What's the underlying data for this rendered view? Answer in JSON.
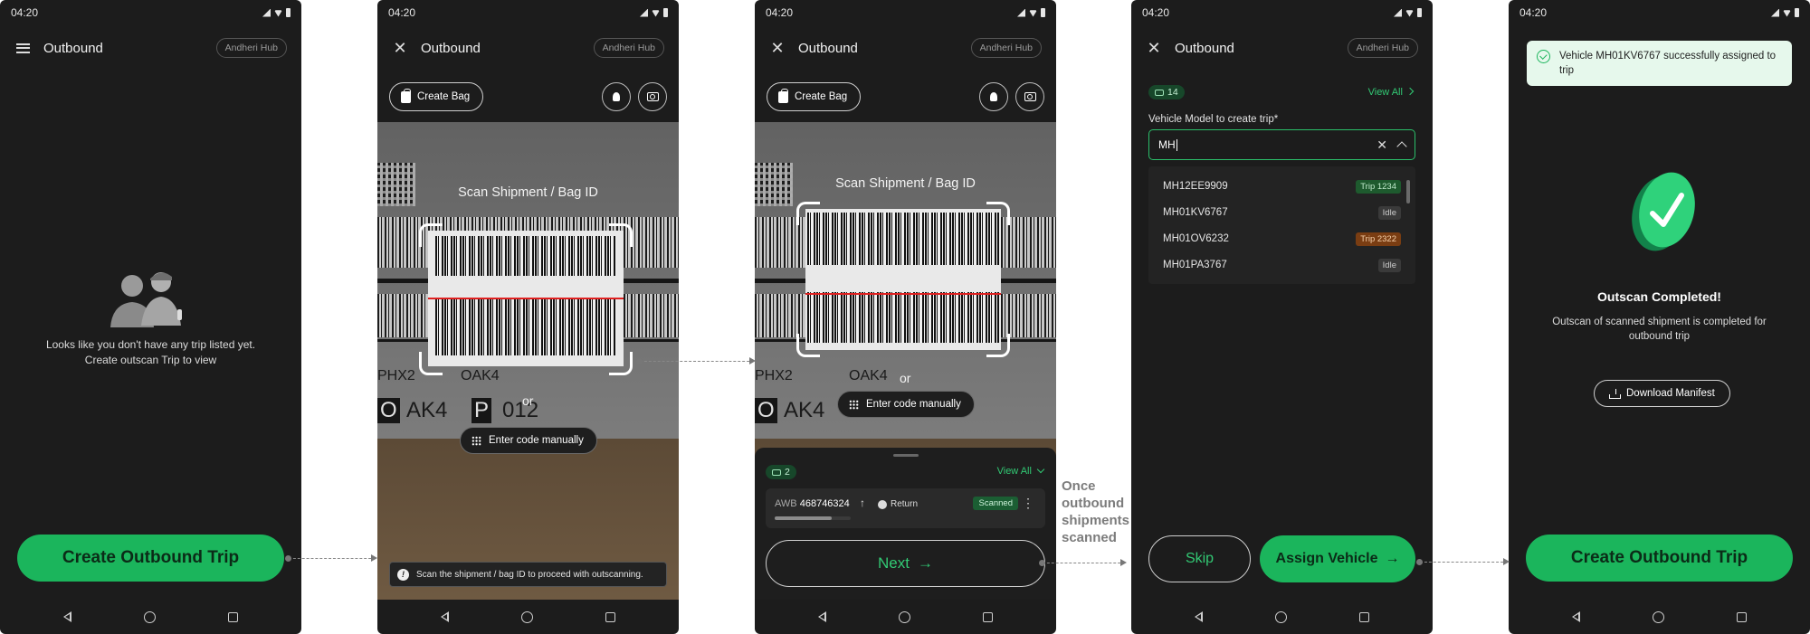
{
  "status_time": "04:20",
  "screen1": {
    "title": "Outbound",
    "hub": "Andheri Hub",
    "empty_line1": "Looks like you don't have any trip listed yet.",
    "empty_line2": "Create outscan Trip to view",
    "cta": "Create Outbound Trip"
  },
  "screen2": {
    "title": "Outbound",
    "hub": "Andheri Hub",
    "create_bag": "Create Bag",
    "scan_label": "Scan Shipment / Bag ID",
    "or": "or",
    "enter_manual": "Enter code manually",
    "print_phx": "PHX2",
    "print_oak": "OAK4",
    "print_o": "O",
    "print_ak4": "AK4",
    "print_p": "P",
    "print_012": "012",
    "info": "Scan the shipment / bag ID to proceed with outscanning."
  },
  "screen3": {
    "title": "Outbound",
    "hub": "Andheri Hub",
    "create_bag": "Create Bag",
    "scan_label": "Scan Shipment / Bag ID",
    "or": "or",
    "enter_manual": "Enter code manually",
    "print_phx": "PHX2",
    "print_oak": "OAK4",
    "print_o": "O",
    "print_ak4": "AK4",
    "count": "2",
    "view_all": "View All",
    "awb_prefix": "AWB",
    "awb_number": "468746324",
    "return_label": "Return",
    "scanned": "Scanned",
    "progress_fraction": 0.75,
    "next": "Next"
  },
  "screen4": {
    "title": "Outbound",
    "hub": "Andheri Hub",
    "count": "14",
    "view_all": "View All",
    "field_label": "Vehicle Model to create trip*",
    "field_value": "MH",
    "options": [
      {
        "vehicle": "MH12EE9909",
        "status": "Trip 1234",
        "color": "#1e5a2e",
        "text_color": "#bfe9cb"
      },
      {
        "vehicle": "MH01KV6767",
        "status": "Idle",
        "color": "#3a3a3a",
        "text_color": "#cccccc"
      },
      {
        "vehicle": "MH01OV6232",
        "status": "Trip 2322",
        "color": "#7a3d12",
        "text_color": "#f5cfa8"
      },
      {
        "vehicle": "MH01PA3767",
        "status": "Idle",
        "color": "#3a3a3a",
        "text_color": "#cccccc"
      }
    ],
    "skip": "Skip",
    "assign": "Assign Vehicle"
  },
  "screen5": {
    "toast": "Vehicle MH01KV6767 successfully assigned to trip",
    "heading": "Outscan Completed!",
    "sub_line1": "Outscan of scanned shipment is completed for",
    "sub_line2": "outbound trip",
    "download": "Download Manifest",
    "cta": "Create Outbound Trip"
  },
  "annotation": {
    "line1": "Once",
    "line2": "outbound",
    "line3": "shipments",
    "line4": "scanned"
  },
  "colors": {
    "accent_green": "#1bb55c",
    "phone_bg": "#1c1c1c"
  }
}
